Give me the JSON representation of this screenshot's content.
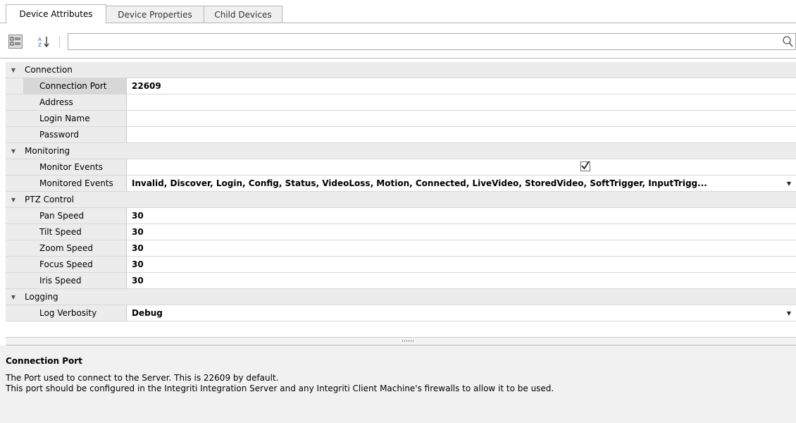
{
  "tabs": [
    {
      "label": "Device Attributes",
      "active": true
    },
    {
      "label": "Device Properties",
      "active": false
    },
    {
      "label": "Child Devices",
      "active": false
    }
  ],
  "toolbar": {
    "categorized_icon": "categorized-view-icon",
    "alphabetical_icon": "sort-alphabetical-icon",
    "search_value": "",
    "search_placeholder": "",
    "search_icon": "magnifier-icon"
  },
  "categories": [
    {
      "label": "Connection",
      "properties": [
        {
          "name": "Connection Port",
          "value": "22609"
        },
        {
          "name": "Address",
          "value": ""
        },
        {
          "name": "Login Name",
          "value": ""
        },
        {
          "name": "Password",
          "value": ""
        }
      ]
    },
    {
      "label": "Monitoring",
      "properties": [
        {
          "name": "Monitor Events",
          "checked": true
        },
        {
          "name": "Monitored Events",
          "value": "Invalid, Discover, Login, Config, Status, VideoLoss, Motion, Connected, LiveVideo, StoredVideo, SoftTrigger, InputTrigg..."
        }
      ]
    },
    {
      "label": "PTZ Control",
      "properties": [
        {
          "name": "Pan Speed",
          "value": "30"
        },
        {
          "name": "Tilt Speed",
          "value": "30"
        },
        {
          "name": "Zoom Speed",
          "value": "30"
        },
        {
          "name": "Focus Speed",
          "value": "30"
        },
        {
          "name": "Iris Speed",
          "value": "30"
        }
      ]
    },
    {
      "label": "Logging",
      "properties": [
        {
          "name": "Log Verbosity",
          "value": "Debug"
        }
      ]
    }
  ],
  "description": {
    "title": "Connection Port",
    "line1": "The Port used to connect to the Server. This is 22609 by default.",
    "line2": "This port should be configured in the Integriti Integration Server and any Integriti Client Machine's firewalls to allow it to be used."
  }
}
